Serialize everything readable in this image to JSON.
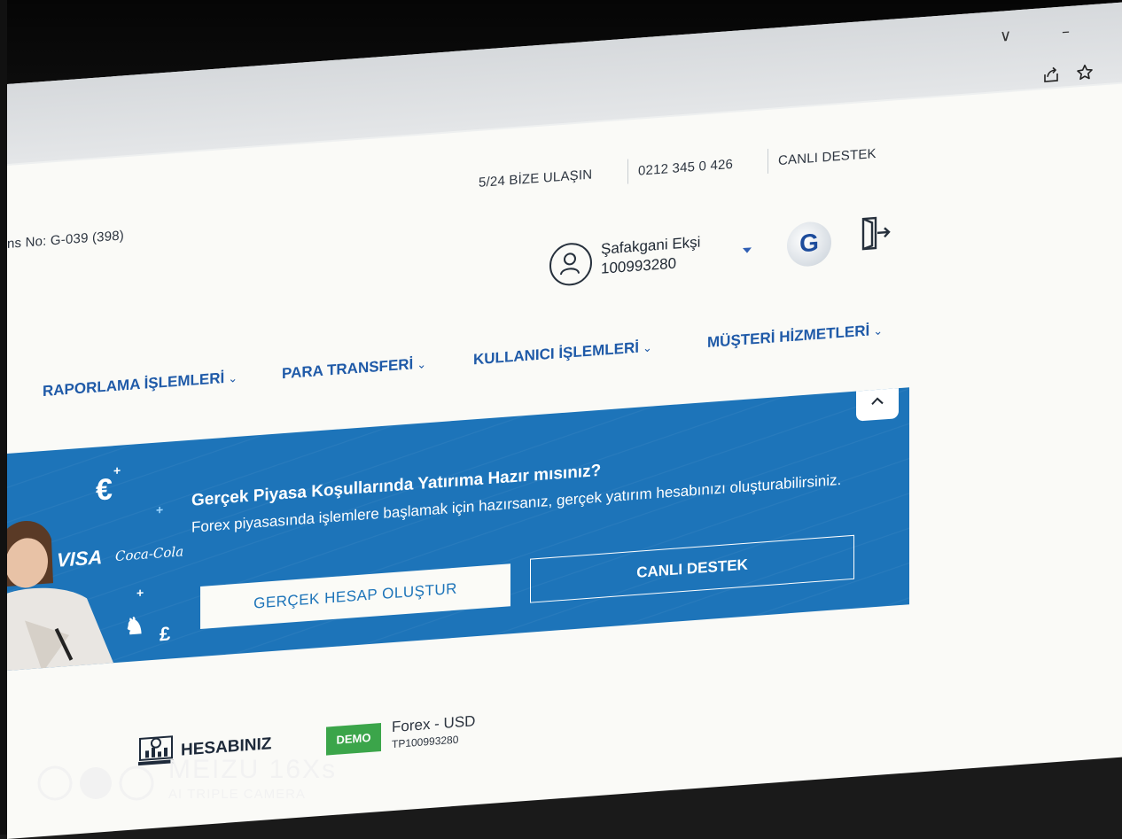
{
  "browser": {
    "window_controls": {
      "chevron": "∨",
      "minimize": "–"
    },
    "toolbar_icons": [
      "share-icon",
      "star-icon"
    ]
  },
  "topbar": {
    "license_text": "ns No: G-039 (398)",
    "contact_label": "5/24 BİZE ULAŞIN",
    "phone": "0212 345 0 426",
    "live_support": "CANLI DESTEK"
  },
  "user": {
    "name": "Şafakgani Ekşi",
    "id": "100993280",
    "logo_letter": "G"
  },
  "nav": {
    "items": [
      {
        "label": "RAPORLAMA İŞLEMLERİ"
      },
      {
        "label": "PARA TRANSFERİ"
      },
      {
        "label": "KULLANICI İŞLEMLERİ"
      },
      {
        "label": "MÜŞTERİ HİZMETLERİ"
      }
    ]
  },
  "banner": {
    "title": "Gerçek Piyasa Koşullarında Yatırıma Hazır mısınız?",
    "description": "Forex piyasasında işlemlere başlamak için hazırsanız, gerçek yatırım hesabınızı oluşturabilirsiniz.",
    "primary_button": "GERÇEK HESAP OLUŞTUR",
    "secondary_button": "CANLI DESTEK",
    "deco": {
      "euro": "€",
      "pound": "£",
      "visa": "VISA",
      "coke": "Coca-Cola"
    },
    "bg_color": "#1d74b9"
  },
  "account": {
    "section_label": "HESABINIZ",
    "badge": "DEMO",
    "type": "Forex - USD",
    "number": "TP100993280"
  },
  "watermark": {
    "brand": "MEIZU 16Xs",
    "sub": "AI TRIPLE CAMERA"
  }
}
